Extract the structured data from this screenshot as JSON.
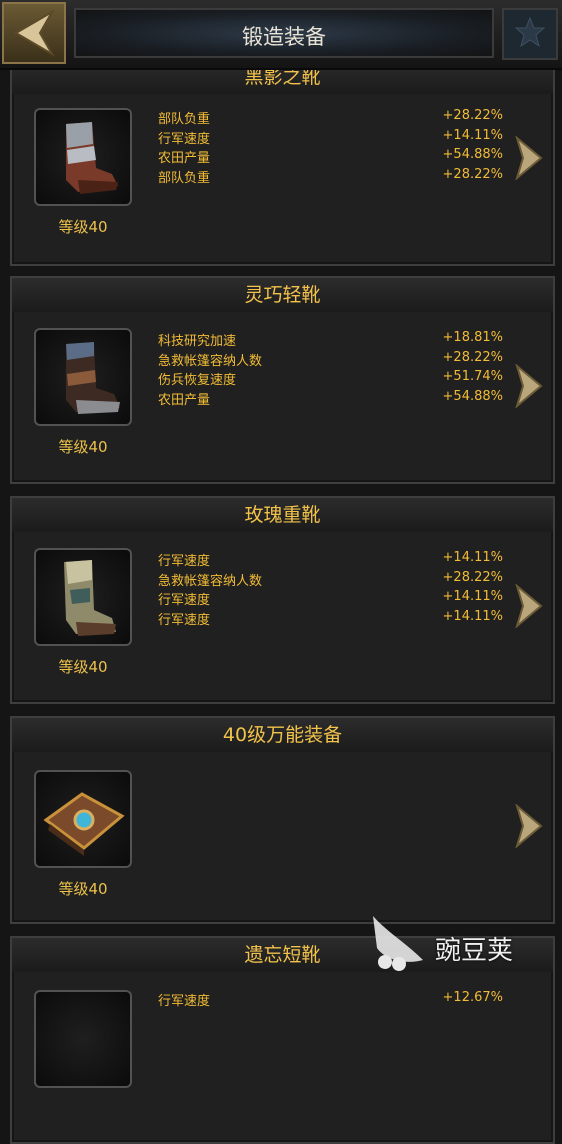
{
  "header": {
    "title": "锻造装备"
  },
  "cards": [
    {
      "title": "黑影之靴",
      "level": "等级40",
      "stats": [
        {
          "name": "部队负重",
          "value": "+28.22%"
        },
        {
          "name": "行军速度",
          "value": "+14.11%"
        },
        {
          "name": "农田产量",
          "value": "+54.88%"
        },
        {
          "name": "部队负重",
          "value": "+28.22%"
        }
      ]
    },
    {
      "title": "灵巧轻靴",
      "level": "等级40",
      "stats": [
        {
          "name": "科技研究加速",
          "value": "+18.81%"
        },
        {
          "name": "急救帐篷容纳人数",
          "value": "+28.22%"
        },
        {
          "name": "伤兵恢复速度",
          "value": "+51.74%"
        },
        {
          "name": "农田产量",
          "value": "+54.88%"
        }
      ]
    },
    {
      "title": "玫瑰重靴",
      "level": "等级40",
      "stats": [
        {
          "name": "行军速度",
          "value": "+14.11%"
        },
        {
          "name": "急救帐篷容纳人数",
          "value": "+28.22%"
        },
        {
          "name": "行军速度",
          "value": "+14.11%"
        },
        {
          "name": "行军速度",
          "value": "+14.11%"
        }
      ]
    },
    {
      "title": "40级万能装备",
      "level": "等级40",
      "stats": []
    },
    {
      "title": "遗忘短靴",
      "level": "",
      "stats": [
        {
          "name": "行军速度",
          "value": "+12.67%"
        }
      ]
    }
  ],
  "watermark": {
    "text": "豌豆荚"
  }
}
